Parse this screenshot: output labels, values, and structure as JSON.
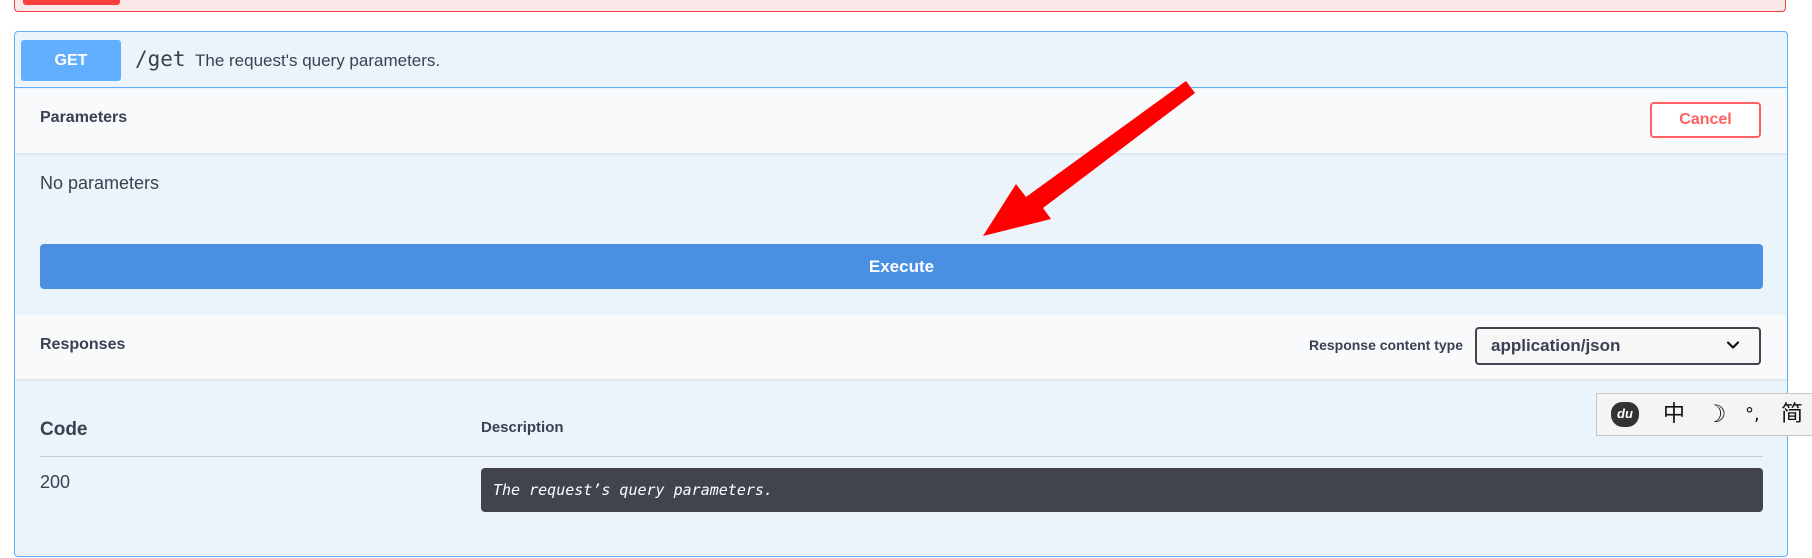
{
  "operation": {
    "method": "GET",
    "path": "/get",
    "summary": "The request's query parameters."
  },
  "parameters": {
    "title": "Parameters",
    "cancel_label": "Cancel",
    "empty_text": "No parameters",
    "execute_label": "Execute"
  },
  "responses": {
    "title": "Responses",
    "content_type_label": "Response content type",
    "content_type_value": "application/json",
    "columns": {
      "code": "Code",
      "description": "Description"
    },
    "rows": [
      {
        "code": "200",
        "description": "The request’s query parameters."
      }
    ]
  },
  "ime_toolbar": {
    "bear_label": "du",
    "lang": "中",
    "moon": "☽",
    "punct": "°,",
    "mode": "简"
  },
  "colors": {
    "get_method": "#61affe",
    "execute": "#4990e2",
    "cancel": "#ff6060",
    "annotation_arrow": "#ff0000"
  }
}
